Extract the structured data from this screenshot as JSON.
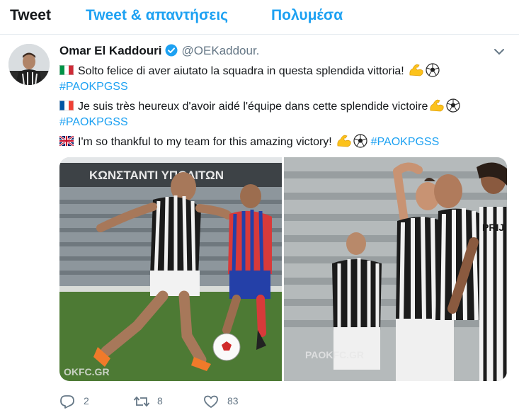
{
  "tabs": [
    {
      "label": "Tweet"
    },
    {
      "label": "Tweet & απαντήσεις"
    },
    {
      "label": "Πολυμέσα"
    }
  ],
  "tweet": {
    "author_name": "Omar El Kaddouri",
    "author_handle": "@OEKaddour.",
    "lines": [
      {
        "flag": "italy",
        "text": "Solto felice di aver aiutato la squadra in questa splendida vittoria!",
        "emoji": [
          "flexed-biceps",
          "soccer-ball"
        ]
      },
      {
        "hashtag": "#PAOKPGSS"
      },
      {
        "flag": "france",
        "text": "Je suis très heureux d'avoir aidé l'équipe dans cette splendide victoire",
        "emoji": [
          "flexed-biceps",
          "soccer-ball"
        ]
      },
      {
        "hashtag": "#PAOKPGSS"
      },
      {
        "flag": "uk",
        "text": "I'm so thankful to my team for this amazing victory!",
        "emoji": [
          "flexed-biceps",
          "soccer-ball"
        ],
        "hashtag": "#PAOKPGSS"
      }
    ],
    "media": {
      "left_banner": "ΚΩΝΣΤΑΝΤΙ ΥΠΟΛΙΤΩΝ",
      "left_watermark": "OKFC.GR",
      "right_watermark": "PAOKFC.GR",
      "right_player_name": "PRIJ"
    },
    "stats": {
      "replies": "2",
      "retweets": "8",
      "likes": "83"
    }
  },
  "colors": {
    "accent": "#1da1f2",
    "text": "#14171a",
    "muted": "#657786",
    "border": "#e6ecf0"
  },
  "icons": [
    "verified-badge-icon",
    "chevron-down-icon",
    "reply-icon",
    "retweet-icon",
    "heart-icon",
    "flag-italy-icon",
    "flag-france-icon",
    "flag-uk-icon",
    "flexed-biceps-icon",
    "soccer-ball-icon"
  ]
}
